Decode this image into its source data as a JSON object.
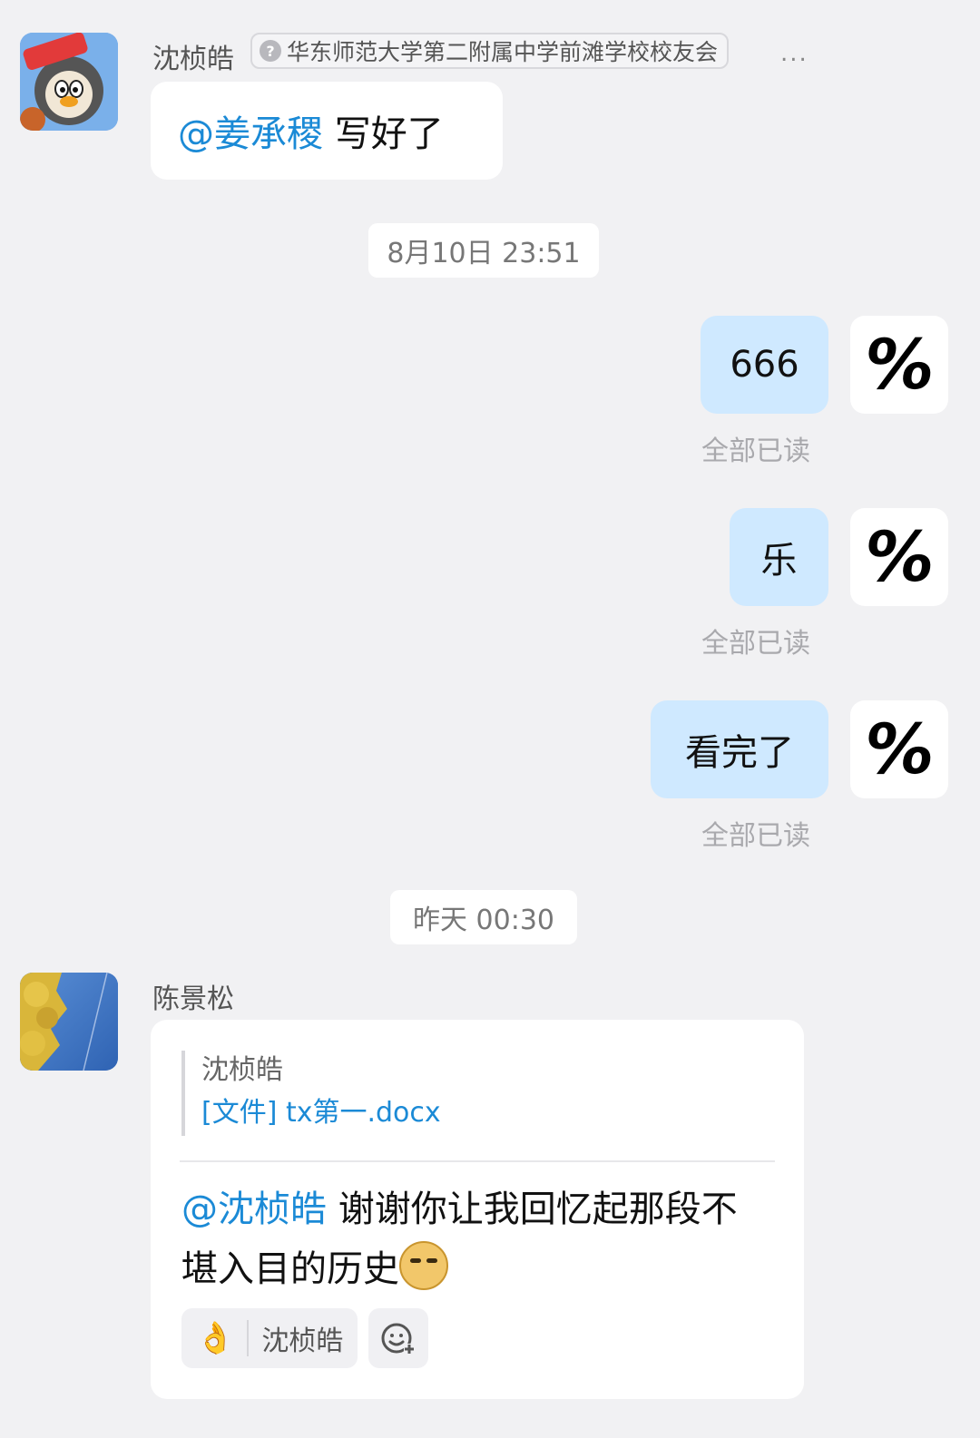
{
  "messages": [
    {
      "sender": "沈桢皓",
      "group_badge": "华东师范大学第二附属中学前滩学校校友会",
      "more": "...",
      "mention": "@姜承稷",
      "text": " 写好了"
    }
  ],
  "timestamps": [
    "8月10日 23:51",
    "昨天 00:30"
  ],
  "self_messages": [
    {
      "text": "666",
      "status": "全部已读"
    },
    {
      "text": "乐",
      "status": "全部已读"
    },
    {
      "text": "看完了",
      "status": "全部已读"
    }
  ],
  "self_avatar_glyph": "%",
  "reply": {
    "sender": "陈景松",
    "quote_sender": "沈桢皓",
    "quote_file": "[文件] tx第一.docx",
    "mention": "@沈桢皓",
    "text": " 谢谢你让我回忆起那段不堪入目的历史",
    "reaction_emoji": "👌",
    "reaction_user": "沈桢皓",
    "add_reaction_icon": "emoji-add-icon"
  },
  "colors": {
    "background": "#f1f1f3",
    "self_bubble": "#cfe9ff",
    "mention": "#1b8ad6",
    "read_status": "#a9a9ad"
  }
}
